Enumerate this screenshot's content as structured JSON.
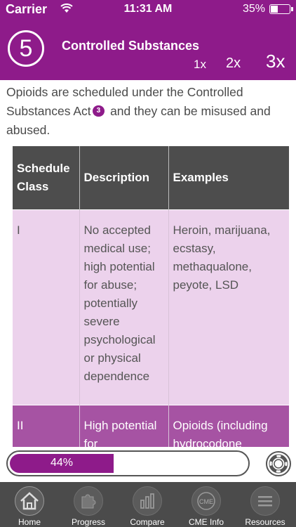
{
  "status": {
    "carrier": "Carrier",
    "time": "11:31 AM",
    "battery": "35%",
    "battery_level": 0.35
  },
  "header": {
    "lesson_number": "5",
    "title": "Controlled Substances",
    "zoom_options": [
      "1x",
      "2x",
      "3x"
    ]
  },
  "content": {
    "intro_before": "Opioids are scheduled under the Controlled Substances Act",
    "reference": "3",
    "intro_after": " and they can be misused and abused.",
    "table": {
      "headers": [
        "Schedule Class",
        "Description",
        "Examples"
      ],
      "rows": [
        [
          "I",
          "No accepted medical use; high potential for abuse; potentially severe psychological or physical dependence",
          "Heroin, marijuana, ecstasy, methaqualone, peyote, LSD"
        ],
        [
          "II",
          "High potential for",
          "Opioids (including hydrocodone"
        ]
      ]
    }
  },
  "progress": {
    "label": "44%",
    "value": 0.44
  },
  "tabs": [
    {
      "label": "Home",
      "icon": "home-icon"
    },
    {
      "label": "Progress",
      "icon": "puzzle-icon"
    },
    {
      "label": "Compare",
      "icon": "bar-chart-icon"
    },
    {
      "label": "CME Info",
      "icon": "cme-icon"
    },
    {
      "label": "Resources",
      "icon": "menu-icon"
    }
  ],
  "colors": {
    "brand": "#8e1b8a",
    "table_header": "#4d4d4d",
    "row_light": "#ecd2ec",
    "row_dark": "#a653a3",
    "tabbar": "#4b4b4b"
  }
}
